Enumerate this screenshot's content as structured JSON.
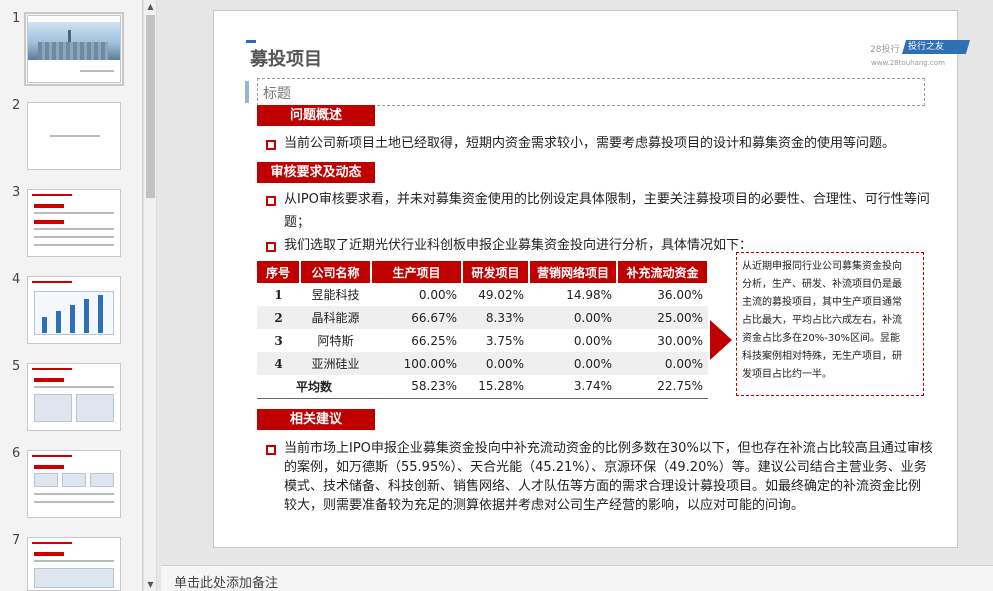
{
  "thumbnails": {
    "numbers": [
      "1",
      "2",
      "3",
      "4",
      "5",
      "6",
      "7"
    ]
  },
  "notes": {
    "placeholder": "单击此处添加备注"
  },
  "slide": {
    "title": "募投项目",
    "subtitle": "标题",
    "logo": {
      "left": "28投行",
      "badge": "投行之友",
      "url": "www.28touhang.com"
    },
    "sections": {
      "s1": "问题概述",
      "s2": "审核要求及动态",
      "s3": "相关建议"
    },
    "bullets": {
      "b1": "当前公司新项目土地已经取得，短期内资金需求较小，需要考虑募投项目的设计和募集资金的使用等问题。",
      "b2a": "从IPO审核要求看，并未对募集资金使用的比例设定具体限制，主要关注募投项目的必要性、合理性、可行性等问",
      "b2b": "题；",
      "b3": "我们选取了近期光伏行业科创板申报企业募集资金投向进行分析，具体情况如下：",
      "b4a": "当前市场上IPO申报企业募集资金投向中补充流动资金的比例多数在30%以下，但也存在补流占比较高且通过审核",
      "b4b": "的案例，如万德斯（55.95%）、天合光能（45.21%）、京源环保（49.20%）等。建议公司结合主营业务、业务",
      "b4c": "模式、技术储备、科技创新、销售网络、人才队伍等方面的需求合理设计募投项目。如最终确定的补流资金比例",
      "b4d": "较大，则需要准备较为充足的测算依据并考虑对公司生产经营的影响，以应对可能的问询。"
    },
    "table": {
      "headers": [
        "序号",
        "公司名称",
        "生产项目",
        "研发项目",
        "营销网络项目",
        "补充流动资金"
      ],
      "rows": [
        [
          "1",
          "昱能科技",
          "0.00%",
          "49.02%",
          "14.98%",
          "36.00%"
        ],
        [
          "2",
          "晶科能源",
          "66.67%",
          "8.33%",
          "0.00%",
          "25.00%"
        ],
        [
          "3",
          "阿特斯",
          "66.25%",
          "3.75%",
          "0.00%",
          "30.00%"
        ],
        [
          "4",
          "亚洲硅业",
          "100.00%",
          "0.00%",
          "0.00%",
          "0.00%"
        ]
      ],
      "average": [
        "平均数",
        "58.23%",
        "15.28%",
        "3.74%",
        "22.75%"
      ]
    },
    "callout": [
      "从近期申报同行业公司募集资金投向",
      "分析，生产、研发、补流项目仍是最",
      "主流的募投项目，其中生产项目通常",
      "占比最大，平均占比六成左右，补流",
      "资金占比多在20%-30%区间。昱能",
      "科技案例相对特殊，无生产项目，研",
      "发项目占比约一半。"
    ]
  },
  "colors": {
    "accent": "#c00000",
    "brand": "#2f6fb5"
  }
}
